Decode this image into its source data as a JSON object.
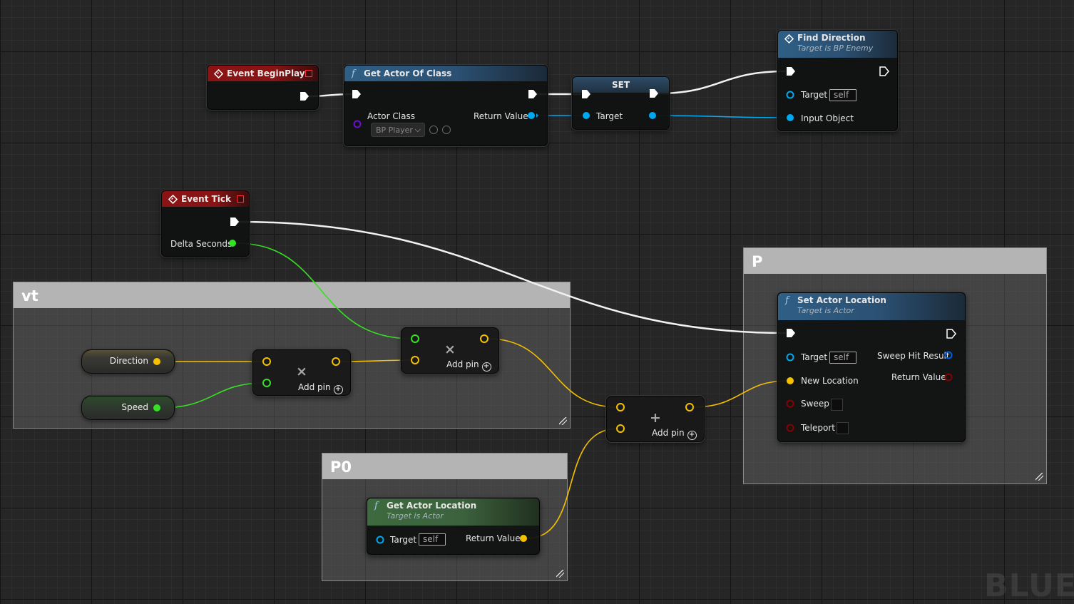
{
  "comments": {
    "vt": "vt",
    "p": "P",
    "p0": "P0"
  },
  "nodes": {
    "begin_play": {
      "title": "Event BeginPlay"
    },
    "get_actor_of_class": {
      "title": "Get Actor Of Class",
      "actor_class_label": "Actor Class",
      "actor_class_value": "BP Player",
      "return_value": "Return Value"
    },
    "set": {
      "title": "SET",
      "target": "Target"
    },
    "find_direction": {
      "title": "Find Direction",
      "subtitle": "Target is BP Enemy",
      "target": "Target",
      "target_default": "self",
      "input_object": "Input Object"
    },
    "event_tick": {
      "title": "Event Tick",
      "delta_seconds": "Delta Seconds"
    },
    "direction_var": {
      "label": "Direction"
    },
    "speed_var": {
      "label": "Speed"
    },
    "multiply_1": {
      "add_pin": "Add pin"
    },
    "multiply_2": {
      "add_pin": "Add pin"
    },
    "add_node": {
      "add_pin": "Add pin"
    },
    "set_actor_location": {
      "title": "Set Actor Location",
      "subtitle": "Target is Actor",
      "target": "Target",
      "target_default": "self",
      "new_location": "New Location",
      "sweep": "Sweep",
      "teleport": "Teleport",
      "sweep_hit_result": "Sweep Hit Result",
      "return_value": "Return Value"
    },
    "get_actor_location": {
      "title": "Get Actor Location",
      "subtitle": "Target is Actor",
      "target": "Target",
      "target_default": "self",
      "return_value": "Return Value"
    }
  },
  "colors": {
    "exec": "#ffffff",
    "object": "#00a8f0",
    "vector": "#f5c000",
    "float": "#36e024",
    "class": "#6a0fd0",
    "struct": "#0060e0",
    "bool": "#8a0000"
  },
  "watermark": "BLUE"
}
